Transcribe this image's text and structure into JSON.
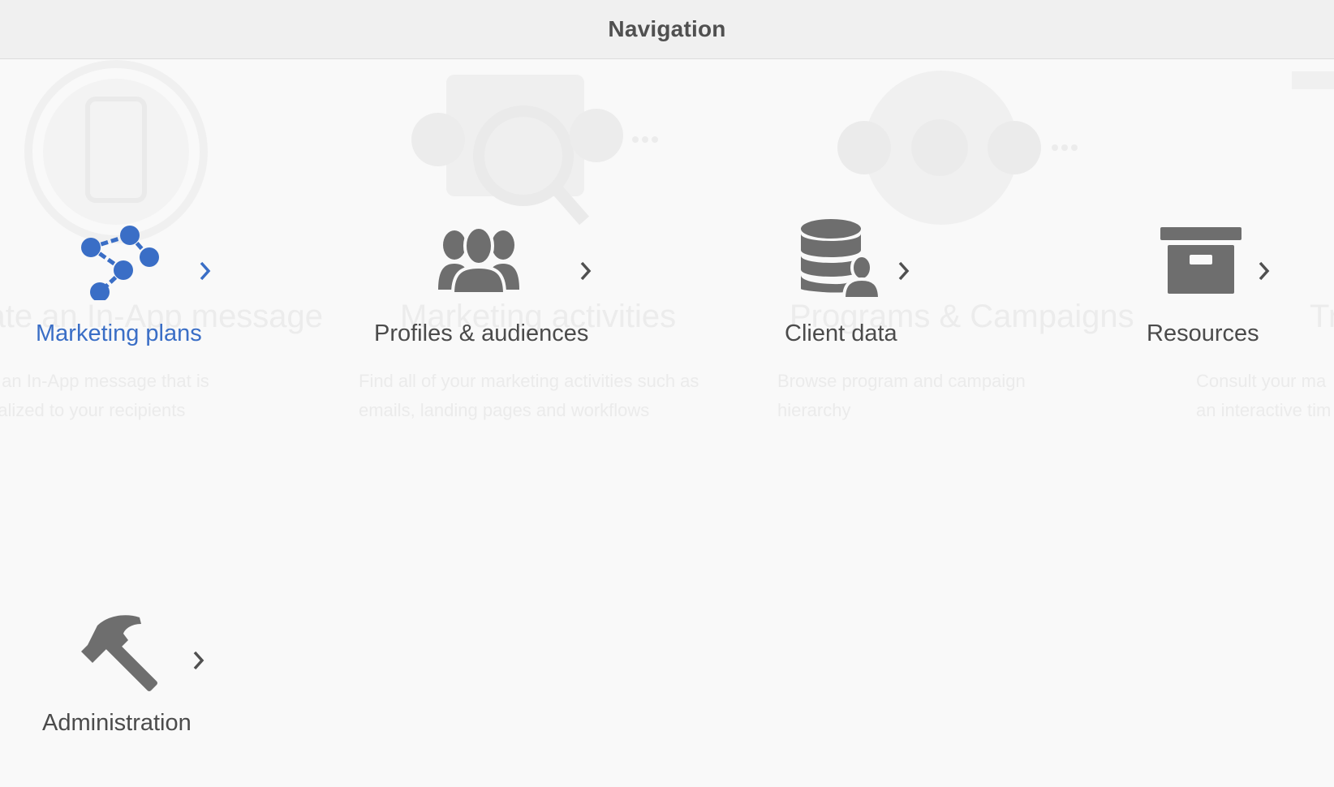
{
  "header": {
    "title": "Navigation"
  },
  "background": {
    "cards": [
      {
        "title": "Create an In-App message",
        "description": "Create an In-App message that is personalized to your recipients"
      },
      {
        "title": "Marketing activities",
        "description": "Find all of your marketing activities such as emails, landing pages and workflows"
      },
      {
        "title": "Programs & Campaigns",
        "description": "Browse program and campaign hierarchy"
      },
      {
        "title": "Tr",
        "description": "Consult your ma an interactive tim"
      }
    ]
  },
  "tiles": [
    {
      "label": "Marketing plans",
      "icon": "marketing-plans-icon",
      "active": true
    },
    {
      "label": "Profiles & audiences",
      "icon": "profiles-audiences-icon",
      "active": false
    },
    {
      "label": "Client data",
      "icon": "client-data-icon",
      "active": false
    },
    {
      "label": "Resources",
      "icon": "resources-icon",
      "active": false
    },
    {
      "label": "Administration",
      "icon": "administration-icon",
      "active": false
    }
  ],
  "colors": {
    "accent": "#3a6ec6",
    "icon": "#6e6e6e",
    "header_bg": "#f0f0f0",
    "page_bg": "#f9f9f9"
  }
}
